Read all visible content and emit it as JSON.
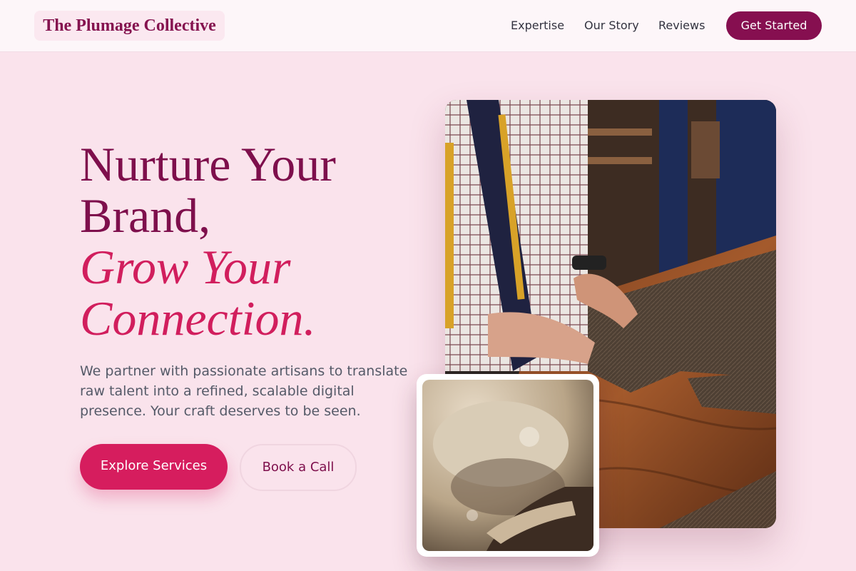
{
  "brand": {
    "name": "The Plumage Collective"
  },
  "nav": {
    "links": [
      "Expertise",
      "Our Story",
      "Reviews"
    ],
    "cta_label": "Get Started"
  },
  "hero": {
    "title_line1": "Nurture Your",
    "title_line2": "Brand,",
    "title_accent_line1": "Grow Your",
    "title_accent_line2": "Connection.",
    "description": "We partner with passionate artisans to translate raw talent into a refined, scalable digital presence. Your craft deserves to be seen.",
    "primary_button": "Explore Services",
    "secondary_button": "Book a Call"
  },
  "images": {
    "main": "photo of a tailor cutting tweed fabric on a wooden workbench",
    "secondary": "close-up photo of floured hands kneading dough"
  },
  "colors": {
    "page_background": "#fae3ec",
    "brand_dark": "#860f50",
    "accent_pink": "#d61d5e",
    "body_text": "#555a68"
  }
}
